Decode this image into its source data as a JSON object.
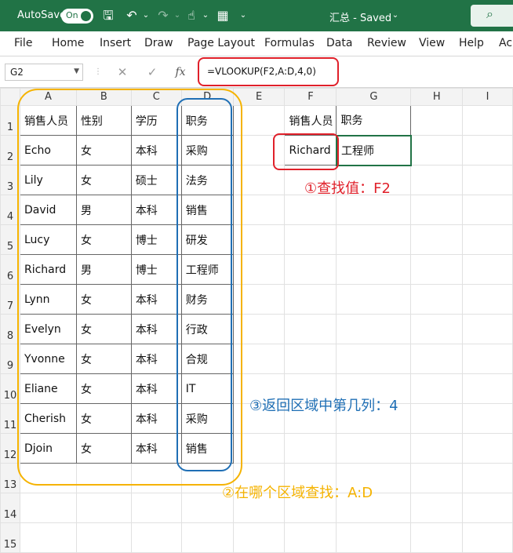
{
  "titlebar": {
    "autosave_label": "AutoSave",
    "toggle_label": "On",
    "doc_title": "汇总 - Saved",
    "title_caret": "⌄"
  },
  "menu": {
    "items": [
      "File",
      "Home",
      "Insert",
      "Draw",
      "Page Layout",
      "Formulas",
      "Data",
      "Review",
      "View",
      "Help",
      "Acr"
    ]
  },
  "formula_bar": {
    "name_box": "G2",
    "fx": "fx",
    "formula": "=VLOOKUP(F2,A:D,4,0)"
  },
  "columns": [
    "A",
    "B",
    "C",
    "D",
    "E",
    "F",
    "G",
    "H",
    "I"
  ],
  "rows": [
    "1",
    "2",
    "3",
    "4",
    "5",
    "6",
    "7",
    "8",
    "9",
    "10",
    "11",
    "12",
    "13",
    "14",
    "15"
  ],
  "table": {
    "headers": [
      "销售人员",
      "性别",
      "学历",
      "职务"
    ],
    "rows": [
      [
        "Echo",
        "女",
        "本科",
        "采购"
      ],
      [
        "Lily",
        "女",
        "硕士",
        "法务"
      ],
      [
        "David",
        "男",
        "本科",
        "销售"
      ],
      [
        "Lucy",
        "女",
        "博士",
        "研发"
      ],
      [
        "Richard",
        "男",
        "博士",
        "工程师"
      ],
      [
        "Lynn",
        "女",
        "本科",
        "财务"
      ],
      [
        "Evelyn",
        "女",
        "本科",
        "行政"
      ],
      [
        "Yvonne",
        "女",
        "本科",
        "合规"
      ],
      [
        "Eliane",
        "女",
        "本科",
        "IT"
      ],
      [
        "Cherish",
        "女",
        "本科",
        "采购"
      ],
      [
        "Djoin",
        "女",
        "本科",
        "销售"
      ]
    ]
  },
  "lookup": {
    "header_f": "销售人员",
    "header_g": "职务",
    "value_f": "Richard",
    "value_g": "工程师"
  },
  "annotations": {
    "step1": "①查找值：F2",
    "step2": "②在哪个区域查找：A:D",
    "step3": "③返回区域中第几列：4"
  },
  "colors": {
    "excel_green": "#217346",
    "annotation_red": "#e0202a",
    "annotation_orange": "#f5b300",
    "annotation_blue": "#1f6fb5"
  }
}
